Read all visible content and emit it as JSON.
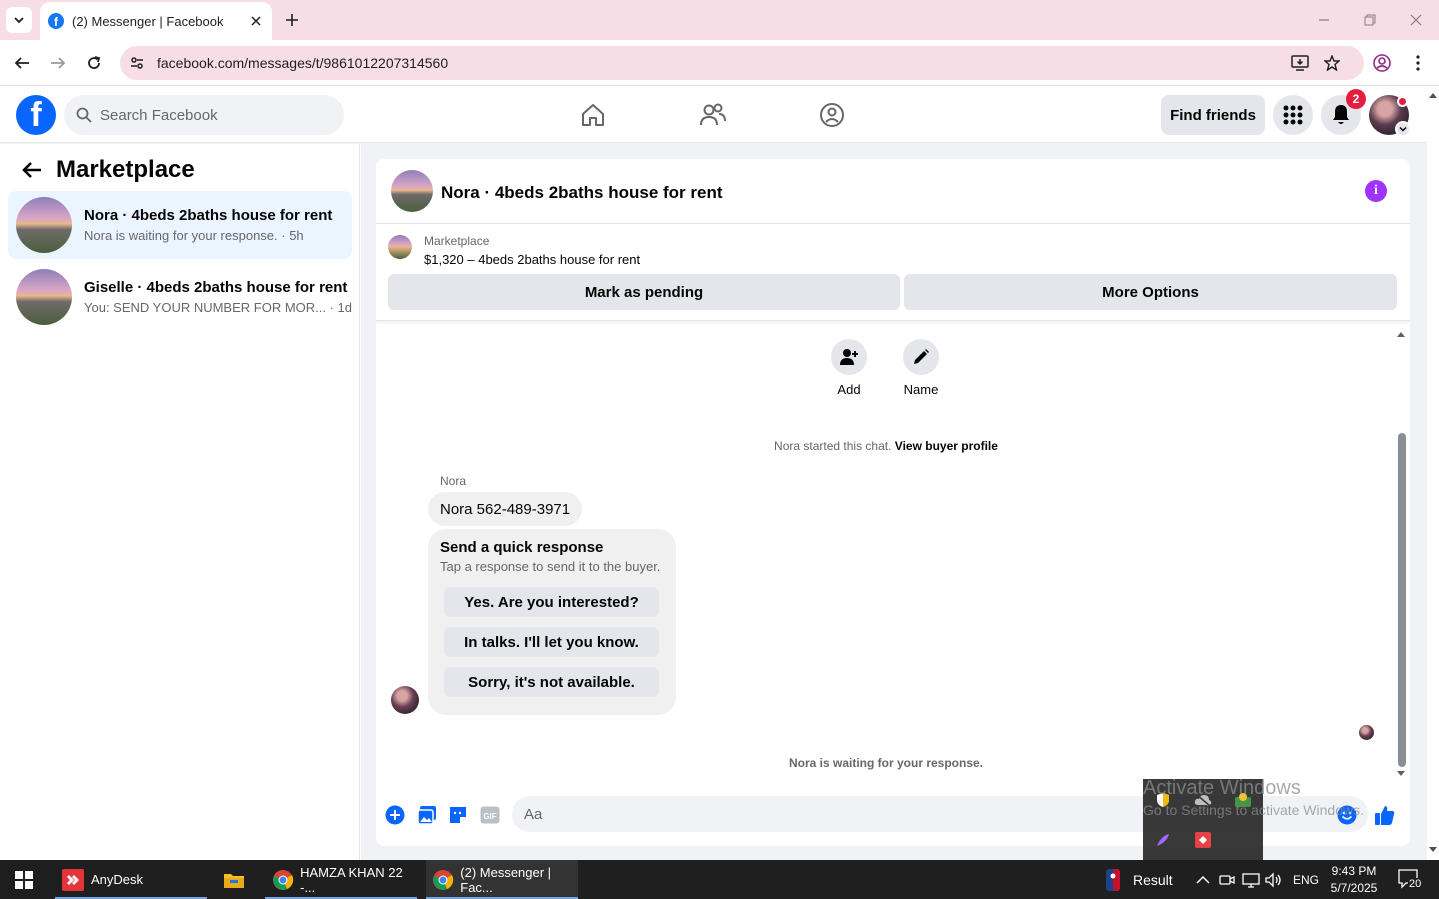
{
  "browser": {
    "tab_title": "(2) Messenger | Facebook",
    "url": "facebook.com/messages/t/9861012207314560"
  },
  "fb_header": {
    "search_placeholder": "Search Facebook",
    "find_friends": "Find friends",
    "notifications_count": "2"
  },
  "left_panel": {
    "title": "Marketplace",
    "conversations": [
      {
        "name": "Nora · 4beds 2baths house for rent",
        "preview": "Nora is waiting for your response. · 5h",
        "active": true
      },
      {
        "name": "Giselle · 4beds 2baths house for rent",
        "preview": "You: SEND YOUR NUMBER FOR MOR... · 1d",
        "active": false
      }
    ]
  },
  "chat": {
    "title": "Nora · 4beds 2baths house for rent",
    "listing": {
      "kicker": "Marketplace",
      "price_line": "$1,320 – 4beds 2baths house for rent",
      "mark_pending": "Mark as pending",
      "more_options": "More Options"
    },
    "quick_actions": {
      "add": "Add",
      "name": "Name"
    },
    "started_text": "Nora started this chat.",
    "view_profile": "View buyer profile",
    "sender_name": "Nora",
    "message": "Nora 562-489-3971",
    "quick_response": {
      "title": "Send a quick response",
      "subtitle": "Tap a response to send it to the buyer.",
      "options": [
        "Yes. Are you interested?",
        "In talks. I'll let you know.",
        "Sorry, it's not available."
      ]
    },
    "waiting_text": "Nora is waiting for your response.",
    "composer_placeholder": "Aa"
  },
  "watermark": {
    "line1": "Activate Windows",
    "line2": "Go to Settings to activate Windows."
  },
  "taskbar": {
    "apps": [
      {
        "label": "AnyDesk"
      },
      {
        "label": "HAMZA KHAN 22 -..."
      },
      {
        "label": "(2) Messenger | Fac..."
      }
    ],
    "result_label": "Result",
    "language": "ENG",
    "time": "9:43 PM",
    "date": "5/7/2025",
    "notif_count": "20"
  },
  "colors": {
    "fb_blue": "#0866ff",
    "accent_purple": "#a033ff",
    "active_conv": "#ebf5ff",
    "tab_strip": "#f7dde6"
  }
}
